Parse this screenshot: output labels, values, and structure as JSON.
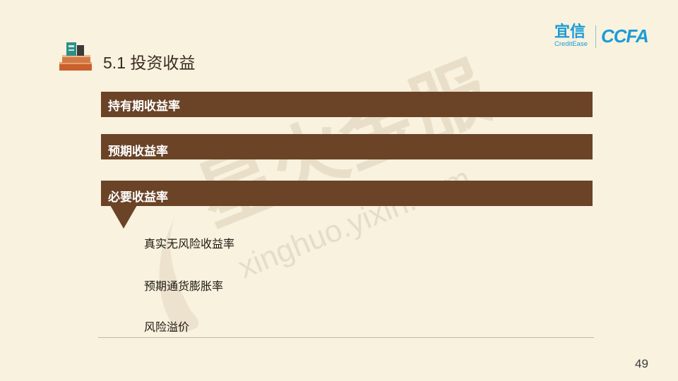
{
  "slide": {
    "title": "5.1 投资收益",
    "page_number": "49"
  },
  "logo": {
    "brand_cn": "宜信",
    "brand_en": "CreditEase",
    "partner": "CCFA"
  },
  "sections": [
    {
      "label": "持有期收益率"
    },
    {
      "label": "预期收益率"
    },
    {
      "label": "必要收益率"
    }
  ],
  "sub_items": [
    {
      "label": "真实无风险收益率"
    },
    {
      "label": "预期通货膨胀率"
    },
    {
      "label": "风险溢价"
    }
  ],
  "watermark": {
    "cn": "星火金服",
    "url": "xinghuo.yixin.com"
  },
  "colors": {
    "background": "#f8f2df",
    "bar": "#6b4327",
    "brand_blue": "#1a9bd6"
  }
}
